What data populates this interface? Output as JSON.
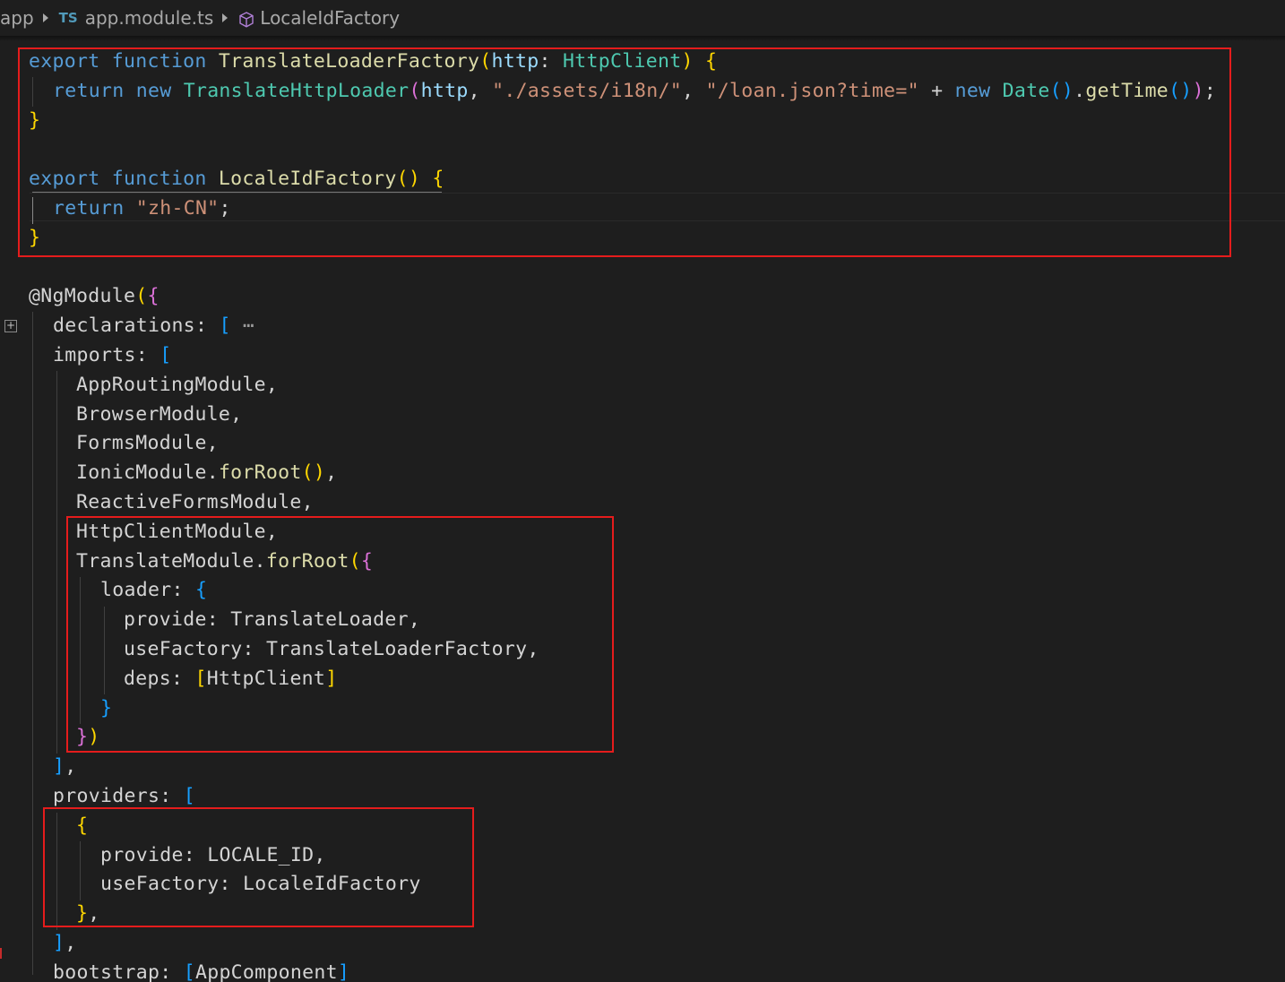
{
  "breadcrumb": {
    "folder": "app",
    "file_lang": "TS",
    "file": "app.module.ts",
    "symbol": "LocaleIdFactory"
  },
  "editor": {
    "colors": {
      "highlight_box": "#e51c1c",
      "keyword": "#569cd6",
      "function": "#dcdcaa",
      "string": "#ce9178"
    },
    "code": {
      "l1_kw1": "export",
      "l1_kw2": "function",
      "l1_fn": "TranslateLoaderFactory",
      "l1_p": "(",
      "l1_param": "http",
      "l1_colon": ": ",
      "l1_type": "HttpClient",
      "l1_pc": ")",
      "l1_brace": "{",
      "l2_kw1": "return",
      "l2_kw2": "new",
      "l2_cls": "TranslateHttpLoader",
      "l2_p": "(",
      "l2_arg": "http",
      "l2_c1": ", ",
      "l2_s1": "\"./assets/i18n/\"",
      "l2_c2": ", ",
      "l2_s2": "\"/loan.json?time=\"",
      "l2_plus": " + ",
      "l2_kw3": "new",
      "l2_date": "Date",
      "l2_p2": "()",
      "l2_dot": ".",
      "l2_gt": "getTime",
      "l2_p3": "()",
      "l2_pend": ")",
      "l2_semi": ";",
      "l3_brace": "}",
      "l5_kw1": "export",
      "l5_kw2": "function",
      "l5_fn": "LocaleIdFactory",
      "l5_p": "()",
      "l5_brace": "{",
      "l6_kw": "return",
      "l6_s": "\"zh-CN\"",
      "l6_semi": ";",
      "l7_brace": "}",
      "l9_at": "@",
      "l9_dec": "NgModule",
      "l9_p": "(",
      "l9_b": "{",
      "l10_key": "declarations",
      "l10_colon": ": ",
      "l10_br": "[",
      "l10_dots": " ⋯",
      "l11_key": "imports",
      "l11_colon": ": ",
      "l11_br": "[",
      "l12": "AppRoutingModule,",
      "l13": "BrowserModule,",
      "l14": "FormsModule,",
      "l15_mod": "IonicModule",
      "l15_dot": ".",
      "l15_fn": "forRoot",
      "l15_p": "()",
      "l15_c": ",",
      "l16": "ReactiveFormsModule,",
      "l17": "HttpClientModule,",
      "l18_mod": "TranslateModule",
      "l18_dot": ".",
      "l18_fn": "forRoot",
      "l18_p": "(",
      "l18_b": "{",
      "l19_key": "loader",
      "l19_colon": ": ",
      "l19_b": "{",
      "l20_key": "provide",
      "l20_colon": ": ",
      "l20_val": "TranslateLoader",
      "l20_c": ",",
      "l21_key": "useFactory",
      "l21_colon": ": ",
      "l21_val": "TranslateLoaderFactory",
      "l21_c": ",",
      "l22_key": "deps",
      "l22_colon": ": ",
      "l22_bo": "[",
      "l22_val": "HttpClient",
      "l22_bc": "]",
      "l23_b": "}",
      "l24_b": "}",
      "l24_p": ")",
      "l25_br": "]",
      "l25_c": ",",
      "l26_key": "providers",
      "l26_colon": ": ",
      "l26_br": "[",
      "l27_b": "{",
      "l28_key": "provide",
      "l28_colon": ": ",
      "l28_val": "LOCALE_ID",
      "l28_c": ",",
      "l29_key": "useFactory",
      "l29_colon": ": ",
      "l29_val": "LocaleIdFactory",
      "l30_b": "}",
      "l30_c": ",",
      "l31_br": "]",
      "l31_c": ",",
      "l32_key": "bootstrap",
      "l32_colon": ": ",
      "l32_bo": "[",
      "l32_val": "AppComponent",
      "l32_bc": "]"
    }
  }
}
